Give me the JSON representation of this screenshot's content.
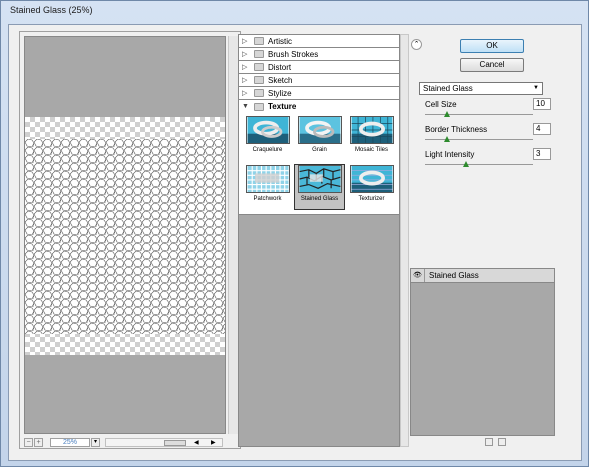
{
  "window": {
    "title": "Stained Glass (25%)"
  },
  "preview": {
    "zoom": "25%",
    "zoom_out": "−",
    "zoom_in": "+",
    "dropdown": "▾"
  },
  "gallery": {
    "categories": [
      {
        "label": "Artistic",
        "expanded": false
      },
      {
        "label": "Brush Strokes",
        "expanded": false
      },
      {
        "label": "Distort",
        "expanded": false
      },
      {
        "label": "Sketch",
        "expanded": false
      },
      {
        "label": "Stylize",
        "expanded": false
      },
      {
        "label": "Texture",
        "expanded": true
      }
    ],
    "texture_filters": [
      {
        "label": "Craquelure",
        "icon": "craquelure-thumb"
      },
      {
        "label": "Grain",
        "icon": "grain-thumb"
      },
      {
        "label": "Mosaic Tiles",
        "icon": "mosaic-tiles-thumb"
      },
      {
        "label": "Patchwork",
        "icon": "patchwork-thumb"
      },
      {
        "label": "Stained Glass",
        "icon": "stained-glass-thumb",
        "selected": true
      },
      {
        "label": "Texturizer",
        "icon": "texturizer-thumb"
      }
    ]
  },
  "buttons": {
    "ok": "OK",
    "cancel": "Cancel"
  },
  "settings": {
    "filter_select": "Stained Glass",
    "params": [
      {
        "label": "Cell Size",
        "value": "10",
        "level": 0.2
      },
      {
        "label": "Border Thickness",
        "value": "4",
        "level": 0.2
      },
      {
        "label": "Light Intensity",
        "value": "3",
        "level": 0.38
      }
    ]
  },
  "layers": {
    "items": [
      {
        "label": "Stained Glass",
        "visible": true
      }
    ]
  },
  "colors": {
    "accent_knob": "#2e8b2e",
    "ok_border": "#3c7fb1",
    "thumb_cyan": "#3fb5d6"
  }
}
